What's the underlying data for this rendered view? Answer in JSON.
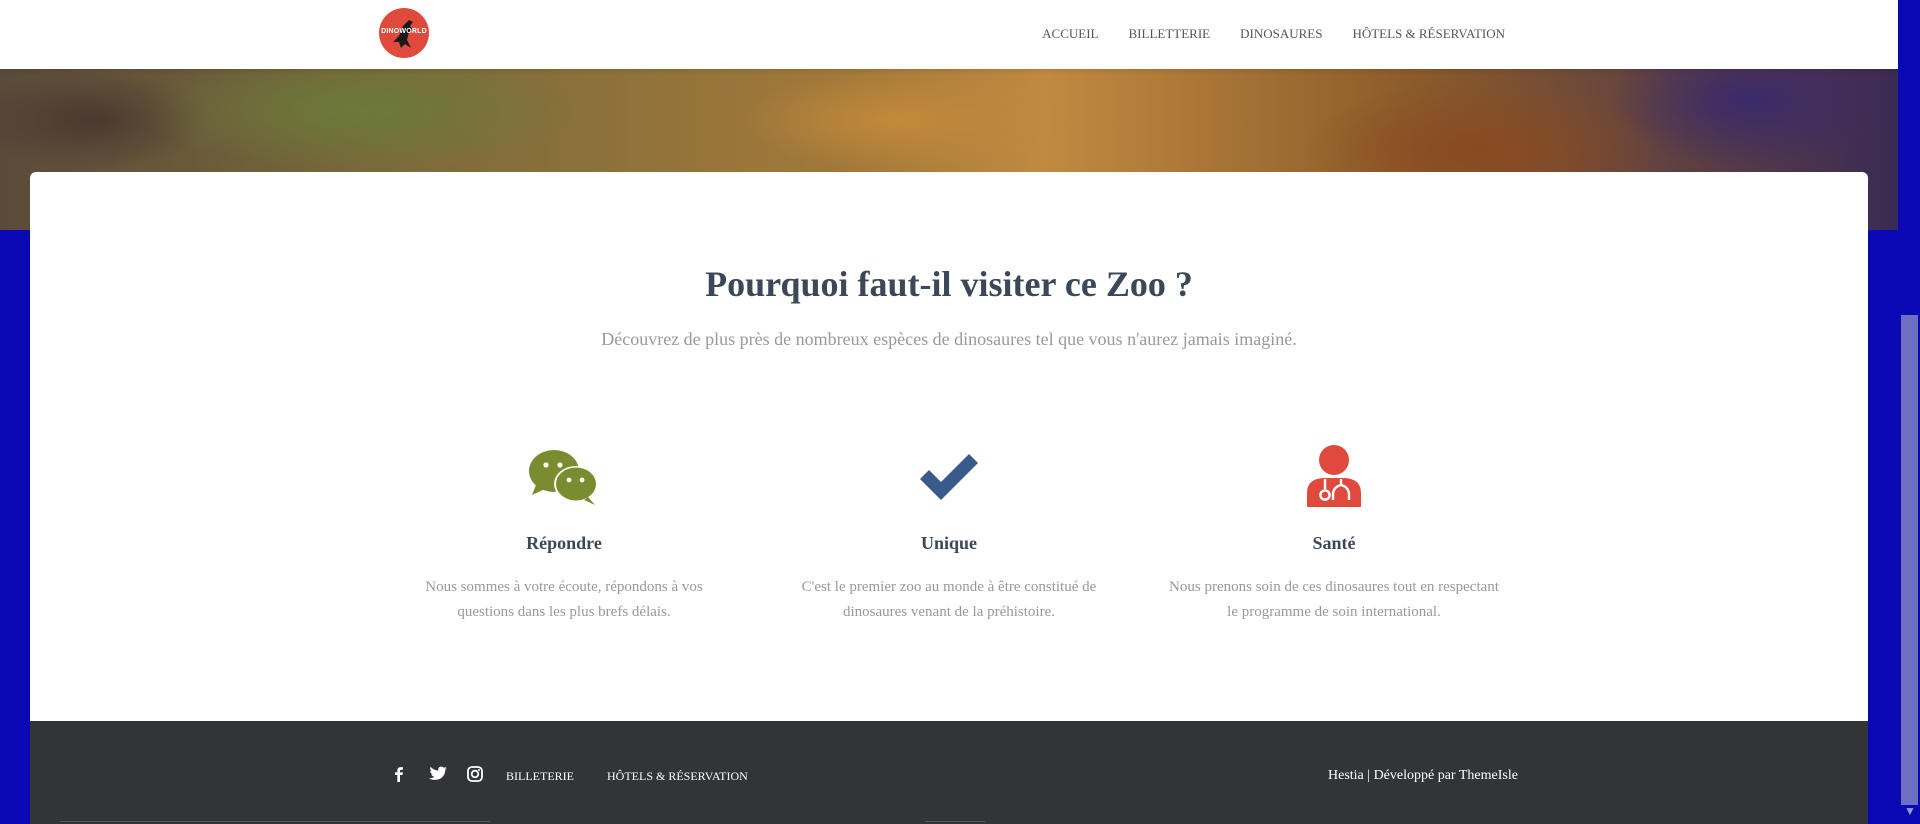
{
  "brand": {
    "logo_text": "DINOWORLD"
  },
  "nav": {
    "items": [
      {
        "label": "ACCUEIL"
      },
      {
        "label": "BILLETTERIE"
      },
      {
        "label": "DINOSAURES"
      },
      {
        "label": "HÔTELS & RÉSERVATION"
      }
    ]
  },
  "features_section": {
    "title": "Pourquoi faut-il visiter ce Zoo ?",
    "subtitle": "Découvrez de plus près de nombreux espèces de dinosaures tel que vous n'aurez jamais imaginé.",
    "items": [
      {
        "icon": "wechat-icon",
        "icon_color": "#7a8c2f",
        "title": "Répondre",
        "text_line1": "Nous sommes à votre écoute, répondons à vos",
        "text_line2": "questions dans les plus brefs délais."
      },
      {
        "icon": "check-icon",
        "icon_color": "#3a5a8c",
        "title": "Unique",
        "text_line1": "C'est le premier zoo au monde à être constitué de",
        "text_line2": "dinosaures venant de la préhistoire."
      },
      {
        "icon": "user-doctor-icon",
        "icon_color": "#e04a3c",
        "title": "Santé",
        "text_line1": "Nous prenons soin de ces dinosaures tout en respectant",
        "text_line2": "le programme de soin international."
      }
    ]
  },
  "footer": {
    "social": [
      {
        "icon": "facebook-icon"
      },
      {
        "icon": "twitter-icon"
      },
      {
        "icon": "instagram-icon"
      }
    ],
    "links": [
      {
        "label": "BILLETERIE"
      },
      {
        "label": "HÔTELS & RÉSERVATION"
      }
    ],
    "copyright": "Hestia | Développé par ThemeIsle"
  },
  "colors": {
    "page_background": "#0a0ab4",
    "title": "#3c4858",
    "muted_text": "#999999",
    "footer_background": "#323437"
  }
}
